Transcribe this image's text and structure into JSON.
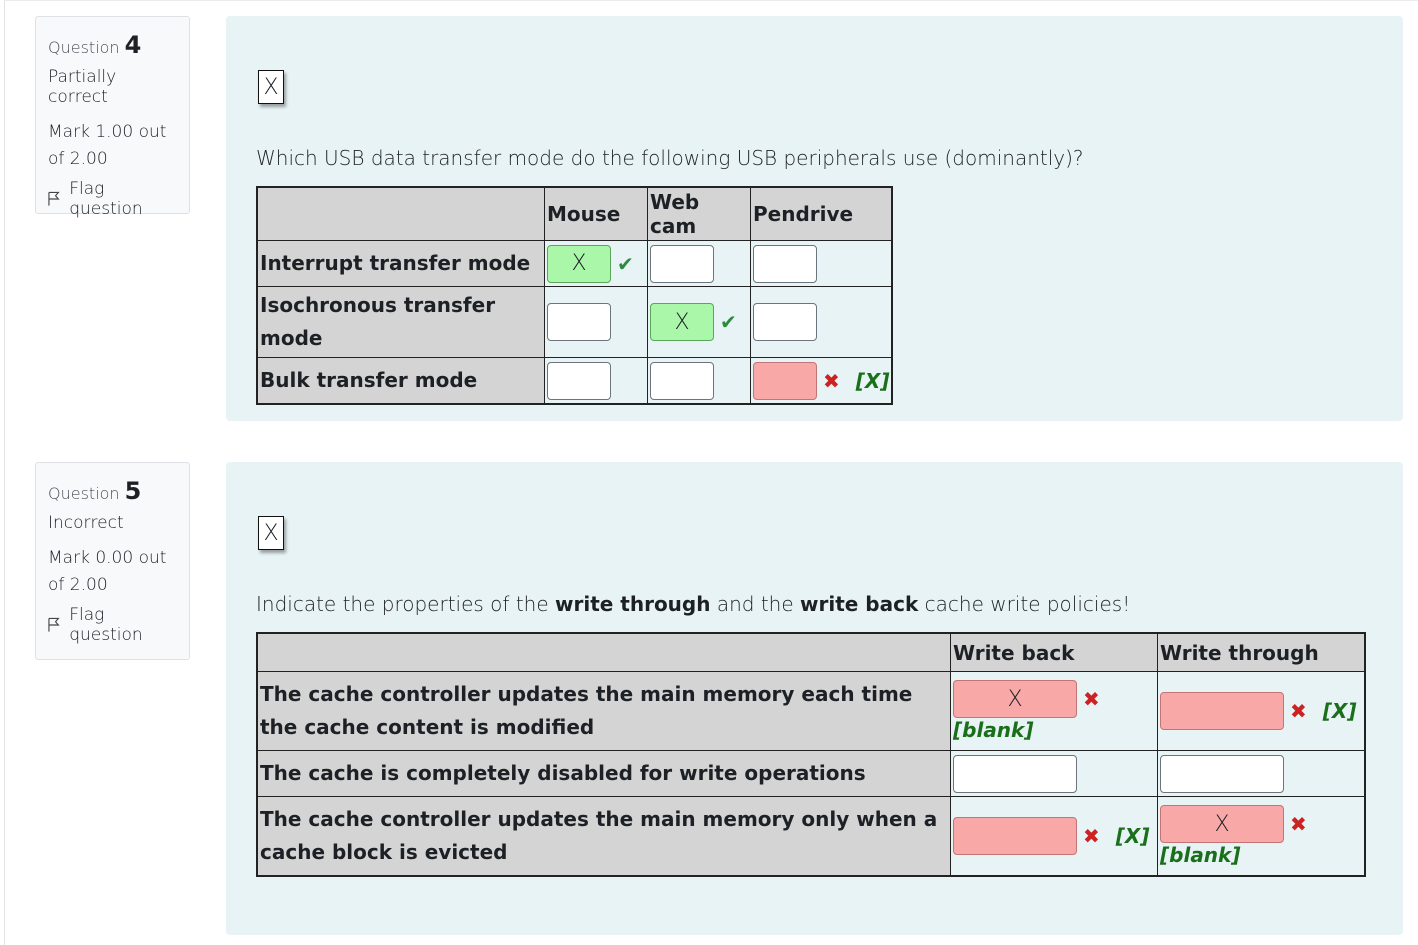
{
  "questions": [
    {
      "label": "Question",
      "number": "4",
      "state": "Partially correct",
      "mark": "Mark 1.00 out of 2.00",
      "flag_label": "Flag question",
      "clear_button": "X",
      "text": "Which USB data transfer mode do the following USB peripherals use (dominantly)?",
      "columns": [
        "Mouse",
        "Web cam",
        "Pendrive"
      ],
      "rows": [
        {
          "label": "Interrupt transfer mode",
          "cells": [
            {
              "value": "X",
              "status": "correct",
              "mark": "✔",
              "answer": ""
            },
            {
              "value": "",
              "status": "none",
              "mark": "",
              "answer": ""
            },
            {
              "value": "",
              "status": "none",
              "mark": "",
              "answer": ""
            }
          ]
        },
        {
          "label": "Isochronous transfer mode",
          "cells": [
            {
              "value": "",
              "status": "none",
              "mark": "",
              "answer": ""
            },
            {
              "value": "X",
              "status": "correct",
              "mark": "✔",
              "answer": ""
            },
            {
              "value": "",
              "status": "none",
              "mark": "",
              "answer": ""
            }
          ]
        },
        {
          "label": "Bulk transfer mode",
          "cells": [
            {
              "value": "",
              "status": "none",
              "mark": "",
              "answer": ""
            },
            {
              "value": "",
              "status": "none",
              "mark": "",
              "answer": ""
            },
            {
              "value": "",
              "status": "incorrect",
              "mark": "✖",
              "answer": "[X]"
            }
          ]
        }
      ]
    },
    {
      "label": "Question",
      "number": "5",
      "state": "Incorrect",
      "mark": "Mark 0.00 out of 2.00",
      "flag_label": "Flag question",
      "clear_button": "X",
      "text_parts": [
        "Indicate the properties of the ",
        "write through",
        " and the ",
        "write back",
        " cache write policies!"
      ],
      "columns": [
        "Write back",
        "Write through"
      ],
      "rows": [
        {
          "label": "The cache controller updates the main memory each time the cache content is modified",
          "cells": [
            {
              "value": "X",
              "status": "incorrect",
              "mark": "✖",
              "answer": "[blank]"
            },
            {
              "value": "",
              "status": "incorrect",
              "mark": "✖",
              "answer": "[X]"
            }
          ]
        },
        {
          "label": "The cache is completely disabled for write operations",
          "cells": [
            {
              "value": "",
              "status": "none",
              "mark": "",
              "answer": ""
            },
            {
              "value": "",
              "status": "none",
              "mark": "",
              "answer": ""
            }
          ]
        },
        {
          "label": "The cache controller updates the main memory only when a cache block is evicted",
          "cells": [
            {
              "value": "",
              "status": "incorrect",
              "mark": "✖",
              "answer": "[X]"
            },
            {
              "value": "X",
              "status": "incorrect",
              "mark": "✖",
              "answer": "[blank]"
            }
          ]
        }
      ]
    }
  ]
}
